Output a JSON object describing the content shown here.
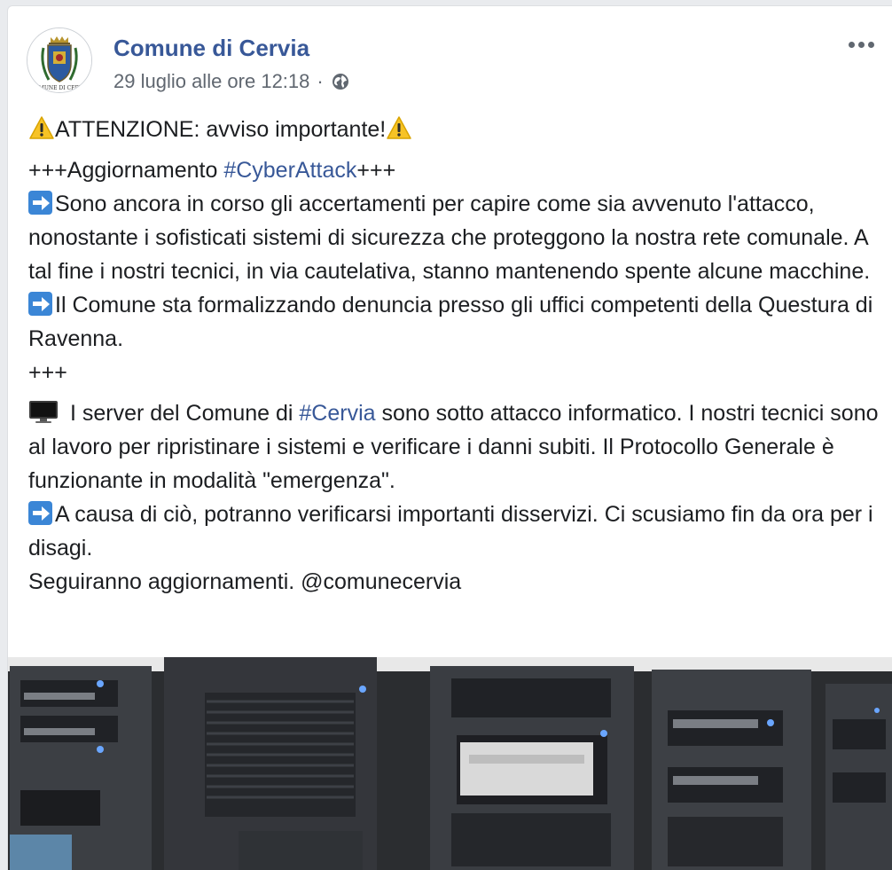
{
  "post": {
    "page_name": "Comune di Cervia",
    "timestamp": "29 luglio alle ore 12:18",
    "separator": "·",
    "avatar_caption": "COMUNE DI CERVIA",
    "icons": {
      "privacy": "globe-icon",
      "menu": "more-options-icon",
      "warning": "warning-emoji",
      "arrow": "right-arrow-emoji",
      "monitor": "desktop-computer-emoji"
    },
    "colors": {
      "link": "#385898",
      "text": "#1c1e21",
      "meta": "#606770",
      "arrow_emoji": "#3b86d6"
    }
  },
  "content": {
    "title": "ATTENZIONE: avviso importante!",
    "update_prefix": "+++Aggiornamento ",
    "update_hashtag": "#CyberAttack",
    "update_suffix": "+++",
    "p1": "Sono ancora in corso gli accertamenti per capire come sia avvenuto l'attacco, nonostante i sofisticati sistemi di sicurezza che proteggono la nostra rete comunale. A tal fine i nostri tecnici, in via cautelativa, stanno mantenendo spente alcune macchine.",
    "p2": "Il Comune sta formalizzando denuncia presso gli uffici competenti della Questura di Ravenna.",
    "end_marker": "+++",
    "p3_prefix": " I server del Comune di ",
    "p3_hashtag": "#Cervia",
    "p3_suffix": " sono sotto attacco informatico. I nostri tecnici sono al lavoro per ripristinare i sistemi e verificare i danni subiti. Il Protocollo Generale è funzionante in modalità \"emergenza\".",
    "p4": "A causa di ciò, potranno verificarsi importanti disservizi. Ci scusiamo fin da ora per i disagi.",
    "p5": "Seguiranno aggiornamenti. @comunecervia"
  }
}
